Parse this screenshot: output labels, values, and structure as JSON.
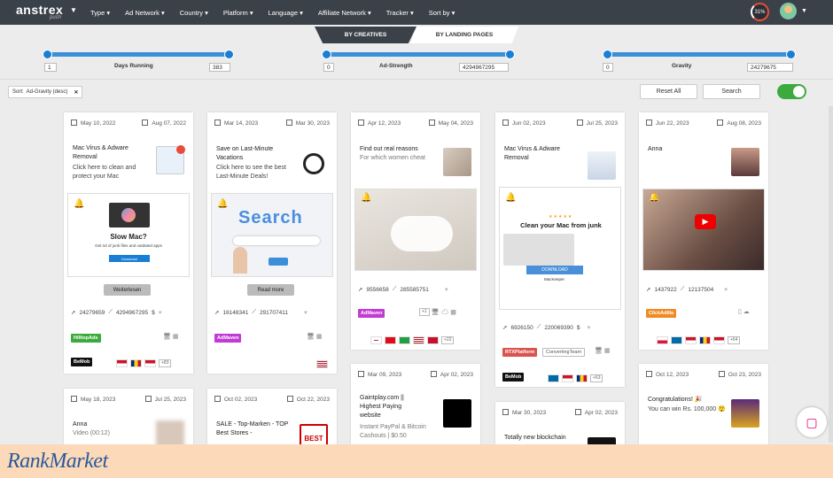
{
  "nav": {
    "logo": "anstrex",
    "logo_sub": "push",
    "items": [
      "Type ▾",
      "Ad Network ▾",
      "Country ▾",
      "Platform ▾",
      "Language ▾",
      "Affiliate Network ▾",
      "Tracker ▾",
      "Sort by ▾"
    ],
    "progress": "31%"
  },
  "tabs": {
    "creatives": "BY CREATIVES",
    "landing": "BY LANDING PAGES"
  },
  "sliders": [
    {
      "label": "Days Running",
      "min": "1",
      "max": "383"
    },
    {
      "label": "Ad-Strength",
      "min": "0",
      "max": "4294967295"
    },
    {
      "label": "Gravity",
      "min": "0",
      "max": "24279675"
    }
  ],
  "filter": {
    "sort_label": "Sort:",
    "sort_value": "Ad-Gravity (desc)",
    "reset": "Reset All",
    "search": "Search"
  },
  "cards": [
    {
      "start": "May 10, 2022",
      "end": "Aug 07, 2022",
      "title": "Mac Virus & Adware Removal",
      "desc": "Click here to clean and protect your Mac",
      "creative_title": "Slow Mac?",
      "creative_sub": "Get rid of junk files and outdated apps",
      "creative_btn": "Download",
      "btn": "Weiterlesen",
      "s1": "24279659",
      "s2": "4294967295",
      "s3": "$",
      "net": "HilltopAds",
      "tracker": "BeMob",
      "more": "+83"
    },
    {
      "start": "Mar 14, 2023",
      "end": "Mar 30, 2023",
      "title": "Save on Last-Minute Vacations",
      "desc": "Click here to see the best Last-Minute Deals!",
      "creative_word": "Search",
      "btn": "Read more",
      "s1": "16148341",
      "s2": "291707411",
      "net": "AdMaven"
    },
    {
      "start": "Apr 12, 2023",
      "end": "May 04, 2023",
      "title": "Find out real reasons",
      "desc": "For which women cheat",
      "s1": "9556658",
      "s2": "285585751",
      "net": "AdMaven",
      "more1": "+1",
      "more": "+22"
    },
    {
      "start": "Jun 02, 2023",
      "end": "Jul 25, 2023",
      "title": "Mac Virus & Adware Removal",
      "creative_title": "Clean your Mac from junk",
      "creative_btn": "DOWNLOAD",
      "creative_brand": "MacKeeper",
      "s1": "6926150",
      "s2": "220069390",
      "s3": "$",
      "net": "RTXPlatform",
      "net2": "ConvertingTeam",
      "tracker": "BeMob",
      "more": "+63"
    },
    {
      "start": "Jun 22, 2023",
      "end": "Aug 08, 2023",
      "title": "Anna",
      "s1": "1437922",
      "s2": "12137504",
      "net": "ClickAdilla",
      "more": "+64"
    },
    {
      "start": "May 18, 2023",
      "end": "Jul 25, 2023",
      "title": "Anna",
      "desc": "Video (00:12)"
    },
    {
      "start": "Oct 02, 2023",
      "end": "Oct 22, 2023",
      "title": "SALE - Top-Marken - TOP Best Stores -",
      "thumb": "BEST"
    },
    {
      "start": "Mar 09, 2023",
      "end": "Apr 02, 2023",
      "title": "Gaintplay.com || Highest Paying website",
      "desc": "Instant PayPal & Bitcoin Cashouts | $0.50"
    },
    {
      "start": "Mar 30, 2023",
      "end": "Apr 02, 2023",
      "title": "Totally new blockchain"
    },
    {
      "start": "Oct 12, 2023",
      "end": "Oct 23, 2023",
      "title": "Congratulations! 🎉",
      "desc": "You can win Rs. 100,000 😲"
    }
  ],
  "footer": {
    "brand": "RankMarket"
  },
  "colors": {
    "nav": "#3b4149",
    "accent": "#1a7fd4",
    "toggle": "#3caa3c"
  }
}
